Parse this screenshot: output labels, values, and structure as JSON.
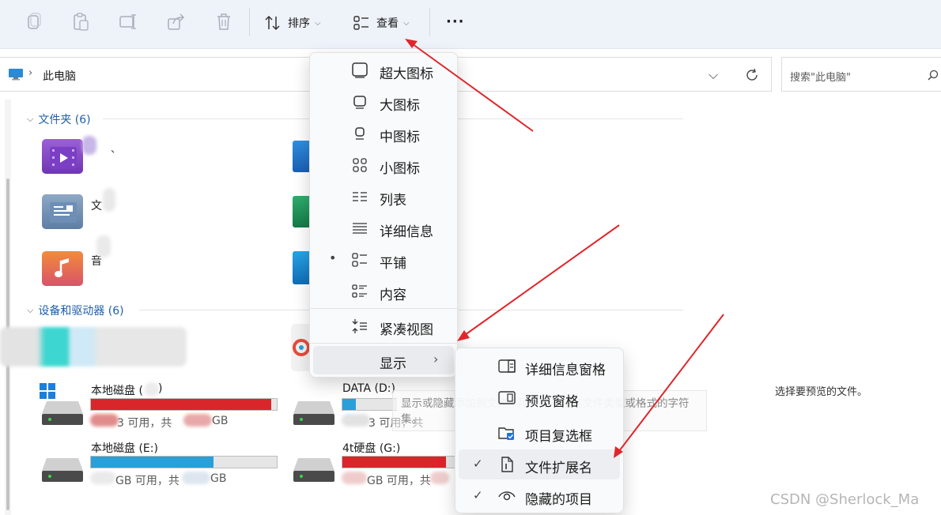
{
  "toolbar": {
    "sort_label": "排序",
    "view_label": "查看",
    "more_label": "···"
  },
  "address": {
    "location": "此电脑",
    "search_placeholder": "搜索\"此电脑\""
  },
  "sections": {
    "folders": "文件夹 (6)",
    "drives": "设备和驱动器 (6)"
  },
  "folders": [
    {
      "name": "视频",
      "partial": "、"
    },
    {
      "name": "文档",
      "partial": "文"
    },
    {
      "name": "音乐",
      "partial": "音"
    }
  ],
  "drives": [
    {
      "name": "本地磁盘 (",
      "name_suffix": ")",
      "sub": "3 可用，共",
      "sub_unit": "GB",
      "used": 0.97,
      "color": "#d9262b"
    },
    {
      "name": "DATA (D:)",
      "name_suffix": "",
      "sub": "3 可用，共",
      "sub_unit": "",
      "used": 0.25,
      "color": "#2a9fd8"
    },
    {
      "name": "本地磁盘 (E:)",
      "name_suffix": "",
      "sub": "GB 可用，共",
      "sub_unit": "GB",
      "used": 0.66,
      "color": "#2a9fd8"
    },
    {
      "name": "4t硬盘 (G:)",
      "name_suffix": "",
      "sub": "GB 可用，共",
      "sub_unit": "",
      "used": 0.9,
      "color": "#d9262b"
    }
  ],
  "view_menu": {
    "items": [
      "超大图标",
      "大图标",
      "中图标",
      "小图标",
      "列表",
      "详细信息",
      "平铺",
      "内容"
    ],
    "selected": "平铺",
    "compact": "紧凑视图",
    "show": "显示"
  },
  "show_menu": {
    "items": [
      {
        "label": "详细信息窗格",
        "checked": false
      },
      {
        "label": "预览窗格",
        "checked": false
      },
      {
        "label": "项目复选框",
        "checked": false
      },
      {
        "label": "文件扩展名",
        "checked": true
      },
      {
        "label": "隐藏的项目",
        "checked": true
      }
    ]
  },
  "tooltip": "显示或隐藏添加到文件末尾、用于指定文件类型或格式的字符集。",
  "preview_pane": "选择要预览的文件。",
  "watermark": "CSDN @Sherlock_Ma",
  "colors": {
    "accent": "#1f5fa8",
    "drive_full": "#d9262b",
    "drive_normal": "#2a9fd8",
    "arrow": "#e0262b"
  }
}
